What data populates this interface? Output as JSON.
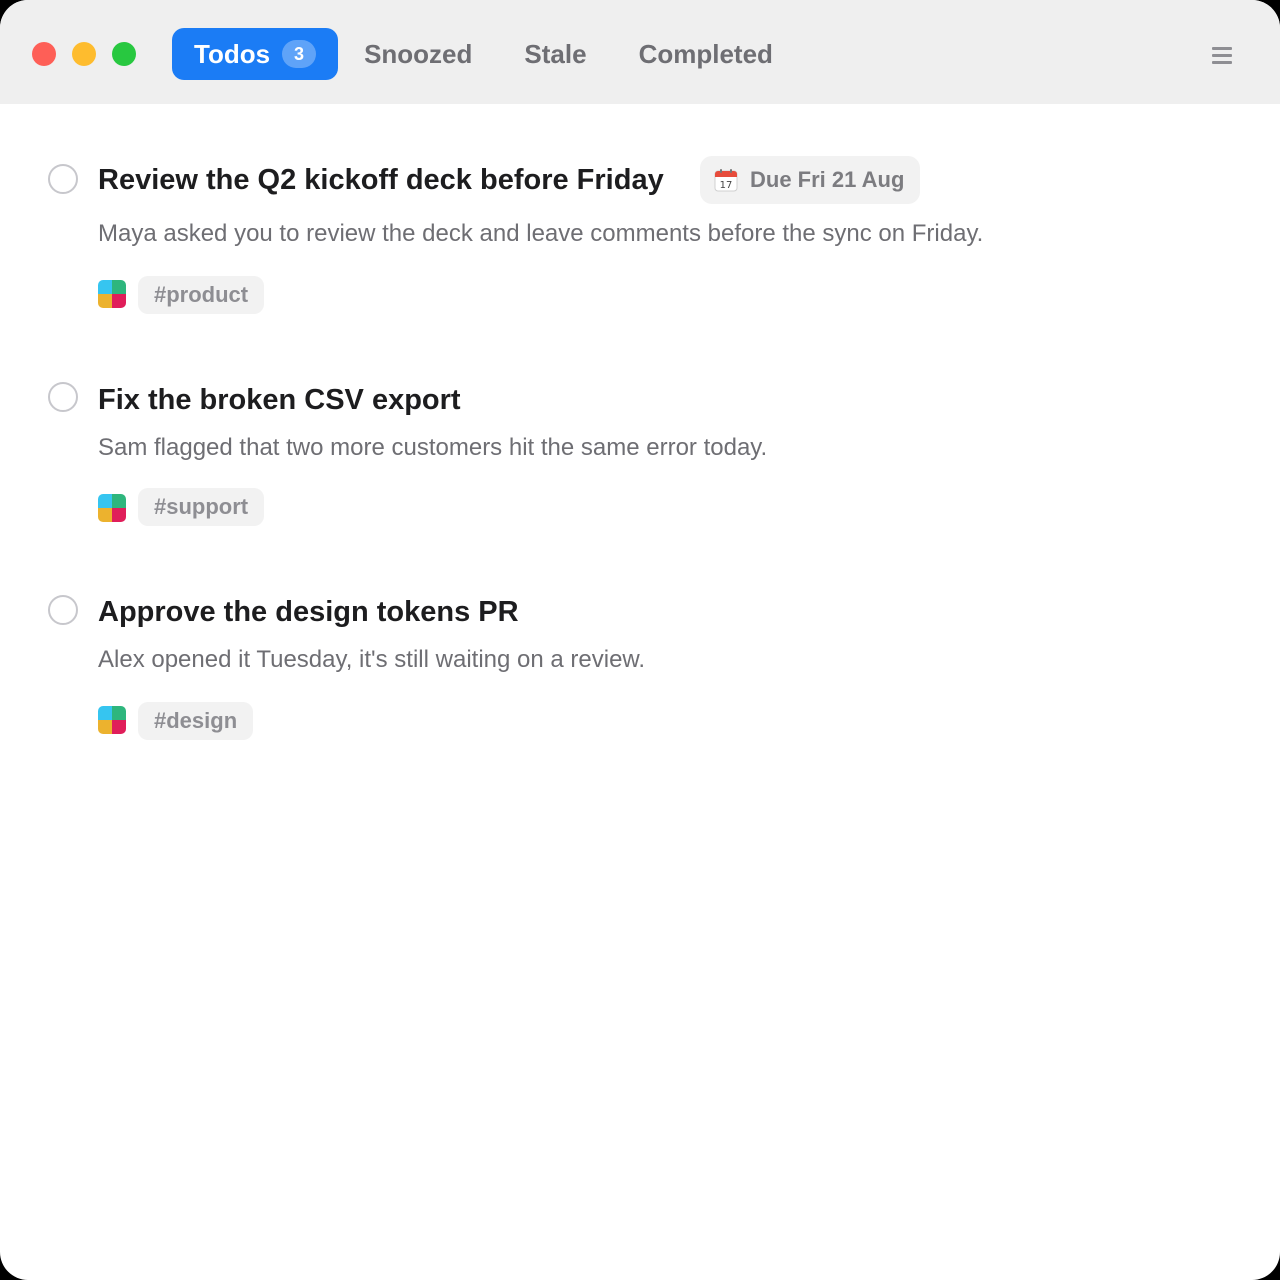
{
  "window": {
    "title_tabs": [
      {
        "label": "Todos",
        "count": "3",
        "active": true
      },
      {
        "label": "Snoozed",
        "active": false
      },
      {
        "label": "Stale",
        "active": false
      },
      {
        "label": "Completed",
        "active": false
      }
    ]
  },
  "colors": {
    "accent": "#1b7cf5",
    "traffic_close": "#fe5f57",
    "traffic_minimize": "#febc2e",
    "traffic_zoom": "#28c840"
  },
  "icons": {
    "menu": "hamburger-menu-icon",
    "due": "calendar-icon",
    "source": "slack-icon",
    "checkbox": "empty-circle-icon"
  },
  "todos": [
    {
      "title": "Review the Q2 kickoff deck before Friday",
      "due": "Due Fri 21 Aug",
      "calendar_day": "17",
      "description": "Maya asked you to review the deck and leave comments before the sync on Friday.",
      "channel": "#product"
    },
    {
      "title": "Fix the broken CSV export",
      "description": "Sam flagged that two more customers hit the same error today.",
      "channel": "#support"
    },
    {
      "title": "Approve the design tokens PR",
      "description": "Alex opened it Tuesday, it's still waiting on a review.",
      "channel": "#design"
    }
  ]
}
